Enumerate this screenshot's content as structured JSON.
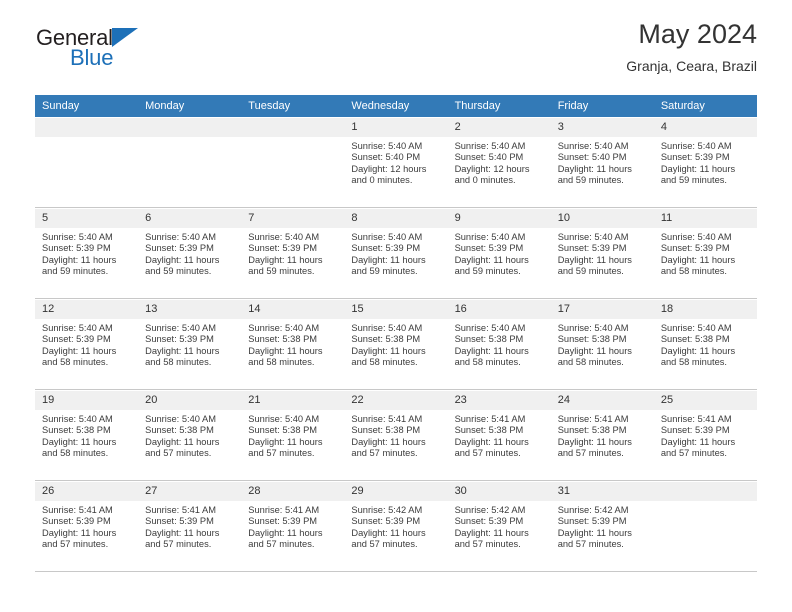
{
  "brand": {
    "line1": "General",
    "line2": "Blue",
    "triangle_color": "#1d70b8"
  },
  "header": {
    "title": "May 2024",
    "subtitle": "Granja, Ceara, Brazil",
    "header_bg": "#337ab7"
  },
  "calendar": {
    "weekday_headers": [
      "Sunday",
      "Monday",
      "Tuesday",
      "Wednesday",
      "Thursday",
      "Friday",
      "Saturday"
    ],
    "weeks": [
      [
        {
          "day": "",
          "empty": true
        },
        {
          "day": "",
          "empty": true
        },
        {
          "day": "",
          "empty": true
        },
        {
          "day": "1",
          "sunrise": "Sunrise: 5:40 AM",
          "sunset": "Sunset: 5:40 PM",
          "daylight1": "Daylight: 12 hours",
          "daylight2": "and 0 minutes."
        },
        {
          "day": "2",
          "sunrise": "Sunrise: 5:40 AM",
          "sunset": "Sunset: 5:40 PM",
          "daylight1": "Daylight: 12 hours",
          "daylight2": "and 0 minutes."
        },
        {
          "day": "3",
          "sunrise": "Sunrise: 5:40 AM",
          "sunset": "Sunset: 5:40 PM",
          "daylight1": "Daylight: 11 hours",
          "daylight2": "and 59 minutes."
        },
        {
          "day": "4",
          "sunrise": "Sunrise: 5:40 AM",
          "sunset": "Sunset: 5:39 PM",
          "daylight1": "Daylight: 11 hours",
          "daylight2": "and 59 minutes."
        }
      ],
      [
        {
          "day": "5",
          "sunrise": "Sunrise: 5:40 AM",
          "sunset": "Sunset: 5:39 PM",
          "daylight1": "Daylight: 11 hours",
          "daylight2": "and 59 minutes."
        },
        {
          "day": "6",
          "sunrise": "Sunrise: 5:40 AM",
          "sunset": "Sunset: 5:39 PM",
          "daylight1": "Daylight: 11 hours",
          "daylight2": "and 59 minutes."
        },
        {
          "day": "7",
          "sunrise": "Sunrise: 5:40 AM",
          "sunset": "Sunset: 5:39 PM",
          "daylight1": "Daylight: 11 hours",
          "daylight2": "and 59 minutes."
        },
        {
          "day": "8",
          "sunrise": "Sunrise: 5:40 AM",
          "sunset": "Sunset: 5:39 PM",
          "daylight1": "Daylight: 11 hours",
          "daylight2": "and 59 minutes."
        },
        {
          "day": "9",
          "sunrise": "Sunrise: 5:40 AM",
          "sunset": "Sunset: 5:39 PM",
          "daylight1": "Daylight: 11 hours",
          "daylight2": "and 59 minutes."
        },
        {
          "day": "10",
          "sunrise": "Sunrise: 5:40 AM",
          "sunset": "Sunset: 5:39 PM",
          "daylight1": "Daylight: 11 hours",
          "daylight2": "and 59 minutes."
        },
        {
          "day": "11",
          "sunrise": "Sunrise: 5:40 AM",
          "sunset": "Sunset: 5:39 PM",
          "daylight1": "Daylight: 11 hours",
          "daylight2": "and 58 minutes."
        }
      ],
      [
        {
          "day": "12",
          "sunrise": "Sunrise: 5:40 AM",
          "sunset": "Sunset: 5:39 PM",
          "daylight1": "Daylight: 11 hours",
          "daylight2": "and 58 minutes."
        },
        {
          "day": "13",
          "sunrise": "Sunrise: 5:40 AM",
          "sunset": "Sunset: 5:39 PM",
          "daylight1": "Daylight: 11 hours",
          "daylight2": "and 58 minutes."
        },
        {
          "day": "14",
          "sunrise": "Sunrise: 5:40 AM",
          "sunset": "Sunset: 5:38 PM",
          "daylight1": "Daylight: 11 hours",
          "daylight2": "and 58 minutes."
        },
        {
          "day": "15",
          "sunrise": "Sunrise: 5:40 AM",
          "sunset": "Sunset: 5:38 PM",
          "daylight1": "Daylight: 11 hours",
          "daylight2": "and 58 minutes."
        },
        {
          "day": "16",
          "sunrise": "Sunrise: 5:40 AM",
          "sunset": "Sunset: 5:38 PM",
          "daylight1": "Daylight: 11 hours",
          "daylight2": "and 58 minutes."
        },
        {
          "day": "17",
          "sunrise": "Sunrise: 5:40 AM",
          "sunset": "Sunset: 5:38 PM",
          "daylight1": "Daylight: 11 hours",
          "daylight2": "and 58 minutes."
        },
        {
          "day": "18",
          "sunrise": "Sunrise: 5:40 AM",
          "sunset": "Sunset: 5:38 PM",
          "daylight1": "Daylight: 11 hours",
          "daylight2": "and 58 minutes."
        }
      ],
      [
        {
          "day": "19",
          "sunrise": "Sunrise: 5:40 AM",
          "sunset": "Sunset: 5:38 PM",
          "daylight1": "Daylight: 11 hours",
          "daylight2": "and 58 minutes."
        },
        {
          "day": "20",
          "sunrise": "Sunrise: 5:40 AM",
          "sunset": "Sunset: 5:38 PM",
          "daylight1": "Daylight: 11 hours",
          "daylight2": "and 57 minutes."
        },
        {
          "day": "21",
          "sunrise": "Sunrise: 5:40 AM",
          "sunset": "Sunset: 5:38 PM",
          "daylight1": "Daylight: 11 hours",
          "daylight2": "and 57 minutes."
        },
        {
          "day": "22",
          "sunrise": "Sunrise: 5:41 AM",
          "sunset": "Sunset: 5:38 PM",
          "daylight1": "Daylight: 11 hours",
          "daylight2": "and 57 minutes."
        },
        {
          "day": "23",
          "sunrise": "Sunrise: 5:41 AM",
          "sunset": "Sunset: 5:38 PM",
          "daylight1": "Daylight: 11 hours",
          "daylight2": "and 57 minutes."
        },
        {
          "day": "24",
          "sunrise": "Sunrise: 5:41 AM",
          "sunset": "Sunset: 5:38 PM",
          "daylight1": "Daylight: 11 hours",
          "daylight2": "and 57 minutes."
        },
        {
          "day": "25",
          "sunrise": "Sunrise: 5:41 AM",
          "sunset": "Sunset: 5:39 PM",
          "daylight1": "Daylight: 11 hours",
          "daylight2": "and 57 minutes."
        }
      ],
      [
        {
          "day": "26",
          "sunrise": "Sunrise: 5:41 AM",
          "sunset": "Sunset: 5:39 PM",
          "daylight1": "Daylight: 11 hours",
          "daylight2": "and 57 minutes."
        },
        {
          "day": "27",
          "sunrise": "Sunrise: 5:41 AM",
          "sunset": "Sunset: 5:39 PM",
          "daylight1": "Daylight: 11 hours",
          "daylight2": "and 57 minutes."
        },
        {
          "day": "28",
          "sunrise": "Sunrise: 5:41 AM",
          "sunset": "Sunset: 5:39 PM",
          "daylight1": "Daylight: 11 hours",
          "daylight2": "and 57 minutes."
        },
        {
          "day": "29",
          "sunrise": "Sunrise: 5:42 AM",
          "sunset": "Sunset: 5:39 PM",
          "daylight1": "Daylight: 11 hours",
          "daylight2": "and 57 minutes."
        },
        {
          "day": "30",
          "sunrise": "Sunrise: 5:42 AM",
          "sunset": "Sunset: 5:39 PM",
          "daylight1": "Daylight: 11 hours",
          "daylight2": "and 57 minutes."
        },
        {
          "day": "31",
          "sunrise": "Sunrise: 5:42 AM",
          "sunset": "Sunset: 5:39 PM",
          "daylight1": "Daylight: 11 hours",
          "daylight2": "and 57 minutes."
        },
        {
          "day": "",
          "empty": true
        }
      ]
    ]
  }
}
